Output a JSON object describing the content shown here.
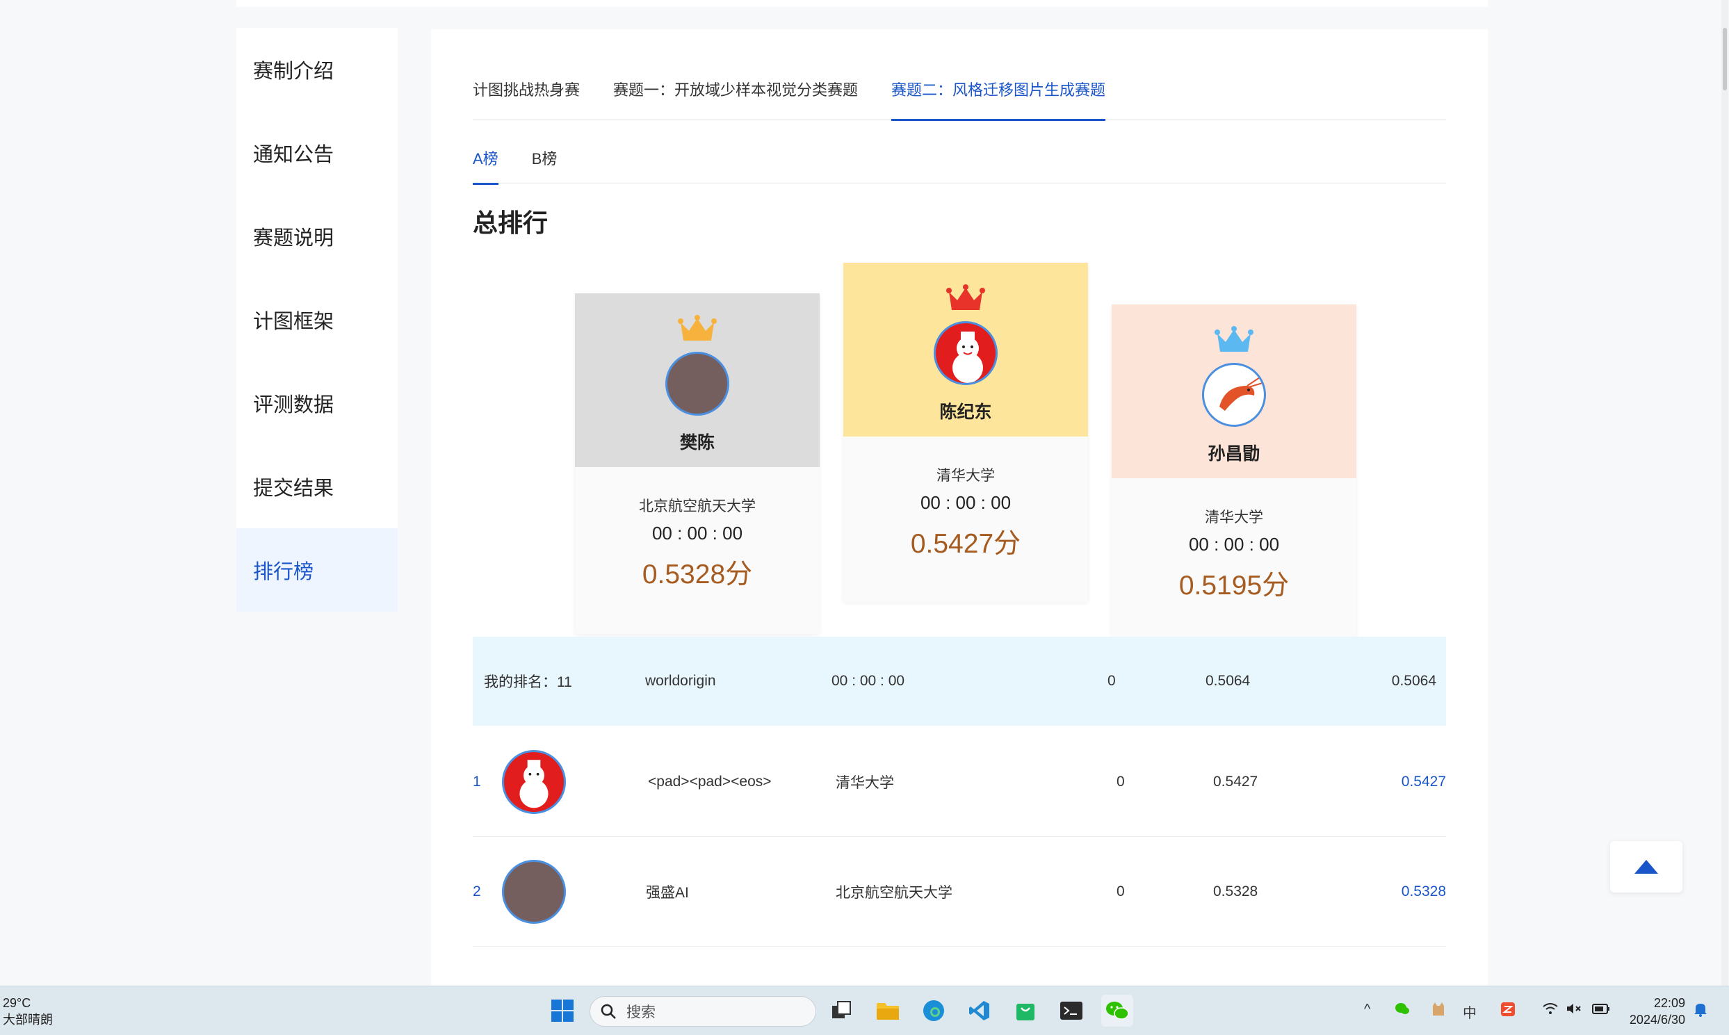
{
  "sidebar": {
    "items": [
      {
        "label": "赛制介绍"
      },
      {
        "label": "通知公告"
      },
      {
        "label": "赛题说明"
      },
      {
        "label": "计图框架"
      },
      {
        "label": "评测数据"
      },
      {
        "label": "提交结果"
      },
      {
        "label": "排行榜"
      }
    ],
    "active_index": 6
  },
  "tabs": [
    {
      "label": "计图挑战热身赛"
    },
    {
      "label": "赛题一：开放域少样本视觉分类赛题"
    },
    {
      "label": "赛题二：风格迁移图片生成赛题"
    }
  ],
  "board_tabs": [
    {
      "label": "A榜"
    },
    {
      "label": "B榜"
    }
  ],
  "section_title": "总排行",
  "podium": {
    "second": {
      "name": "樊陈",
      "school": "北京航空航天大学",
      "time": "00 : 00 : 00",
      "score": "0.5328分",
      "crown": "gold-crown-icon",
      "header_color": "#dcdcdd"
    },
    "first": {
      "name": "陈纪东",
      "school": "清华大学",
      "time": "00 : 00 : 00",
      "score": "0.5427分",
      "crown": "red-crown-icon",
      "header_color": "#fde69b"
    },
    "third": {
      "name": "孙昌勖",
      "school": "清华大学",
      "time": "00 : 00 : 00",
      "score": "0.5195分",
      "crown": "blue-crown-icon",
      "header_color": "#fde4d8"
    }
  },
  "my_rank": {
    "label": "我的排名：11",
    "team": "worldorigin",
    "time": "00 : 00 : 00",
    "count": "0",
    "score": "0.5064",
    "final": "0.5064"
  },
  "rows": [
    {
      "rank": "1",
      "team": "<pad><pad><eos>",
      "school": "清华大学",
      "count": "0",
      "score": "0.5427",
      "final": "0.5427",
      "avatar": "snowman-avatar"
    },
    {
      "rank": "2",
      "team": "强盛AI",
      "school": "北京航空航天大学",
      "count": "0",
      "score": "0.5328",
      "final": "0.5328",
      "avatar": "brown-avatar"
    }
  ],
  "taskbar": {
    "weather_temp": "29°C",
    "weather_desc": "大部晴朗",
    "search_placeholder": "搜索",
    "ime": "中",
    "time": "22:09",
    "date": "2024/6/30"
  }
}
